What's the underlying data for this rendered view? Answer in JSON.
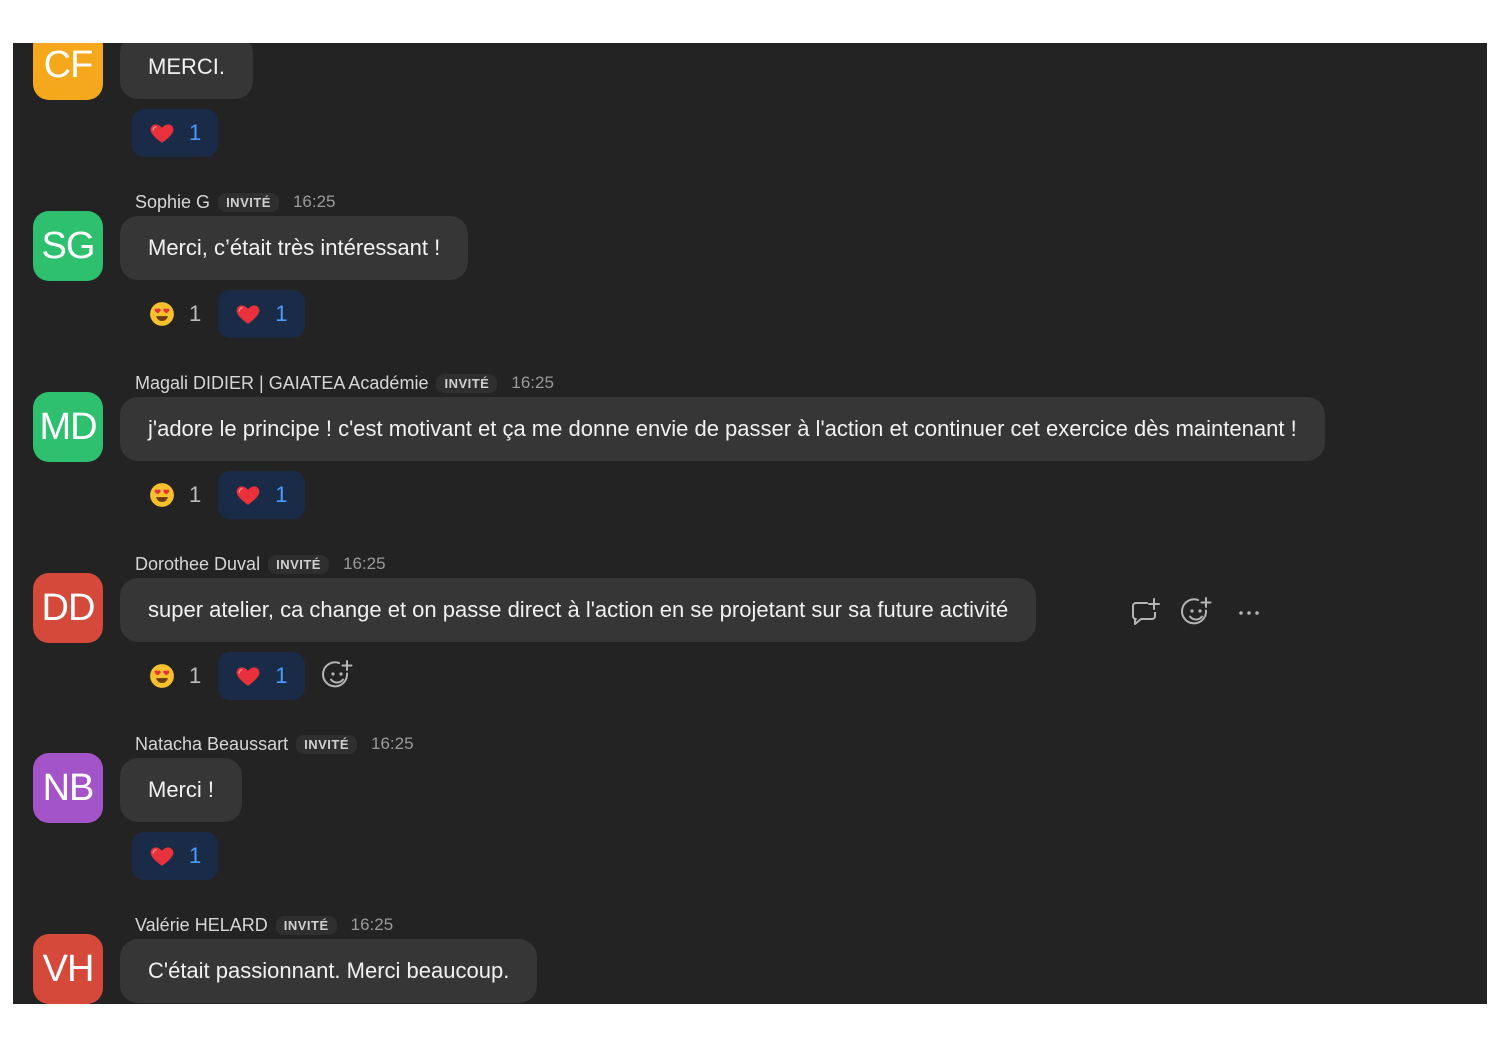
{
  "colors": {
    "panel_bg": "#232323",
    "bubble_bg": "#363636",
    "reaction_active_bg": "#1a2b47",
    "reaction_active_count": "#4a9bff"
  },
  "messages": [
    {
      "initials": "CF",
      "avatar_color": "#f5a81c",
      "sender": "",
      "badge": "",
      "time": "",
      "text": "MERCI.",
      "reactions": [
        {
          "emoji": "heart-icon",
          "count": "1",
          "mine": true
        }
      ]
    },
    {
      "initials": "SG",
      "avatar_color": "#2fc06f",
      "sender": "Sophie G",
      "badge": "INVITÉ",
      "time": "16:25",
      "text": "Merci, c’était très intéressant  !",
      "reactions": [
        {
          "emoji": "heart-eyes-icon",
          "count": "1",
          "mine": false
        },
        {
          "emoji": "heart-icon",
          "count": "1",
          "mine": true
        }
      ]
    },
    {
      "initials": "MD",
      "avatar_color": "#2fc06f",
      "sender": "Magali DIDIER | GAIATEA Académie",
      "badge": "INVITÉ",
      "time": "16:25",
      "text": "j'adore le principe ! c'est motivant et ça me donne envie de passer à l'action et continuer cet exercice dès maintenant !",
      "reactions": [
        {
          "emoji": "heart-eyes-icon",
          "count": "1",
          "mine": false
        },
        {
          "emoji": "heart-icon",
          "count": "1",
          "mine": true
        }
      ]
    },
    {
      "initials": "DD",
      "avatar_color": "#d4493a",
      "sender": "Dorothee Duval",
      "badge": "INVITÉ",
      "time": "16:25",
      "text": "super atelier, ca change et on passe direct à l'action en se projetant sur sa future activité",
      "reactions": [
        {
          "emoji": "heart-eyes-icon",
          "count": "1",
          "mine": false
        },
        {
          "emoji": "heart-icon",
          "count": "1",
          "mine": true
        }
      ]
    },
    {
      "initials": "NB",
      "avatar_color": "#a454c9",
      "sender": "Natacha Beaussart",
      "badge": "INVITÉ",
      "time": "16:25",
      "text": "Merci !",
      "reactions": [
        {
          "emoji": "heart-icon",
          "count": "1",
          "mine": true
        }
      ]
    },
    {
      "initials": "VH",
      "avatar_color": "#d4493a",
      "sender": "Valérie HELARD",
      "badge": "INVITÉ",
      "time": "16:25",
      "text": "C'était passionnant. Merci beaucoup.",
      "reactions": []
    }
  ],
  "hover_actions": [
    "reply-icon",
    "add-reaction-icon",
    "more-icon"
  ]
}
